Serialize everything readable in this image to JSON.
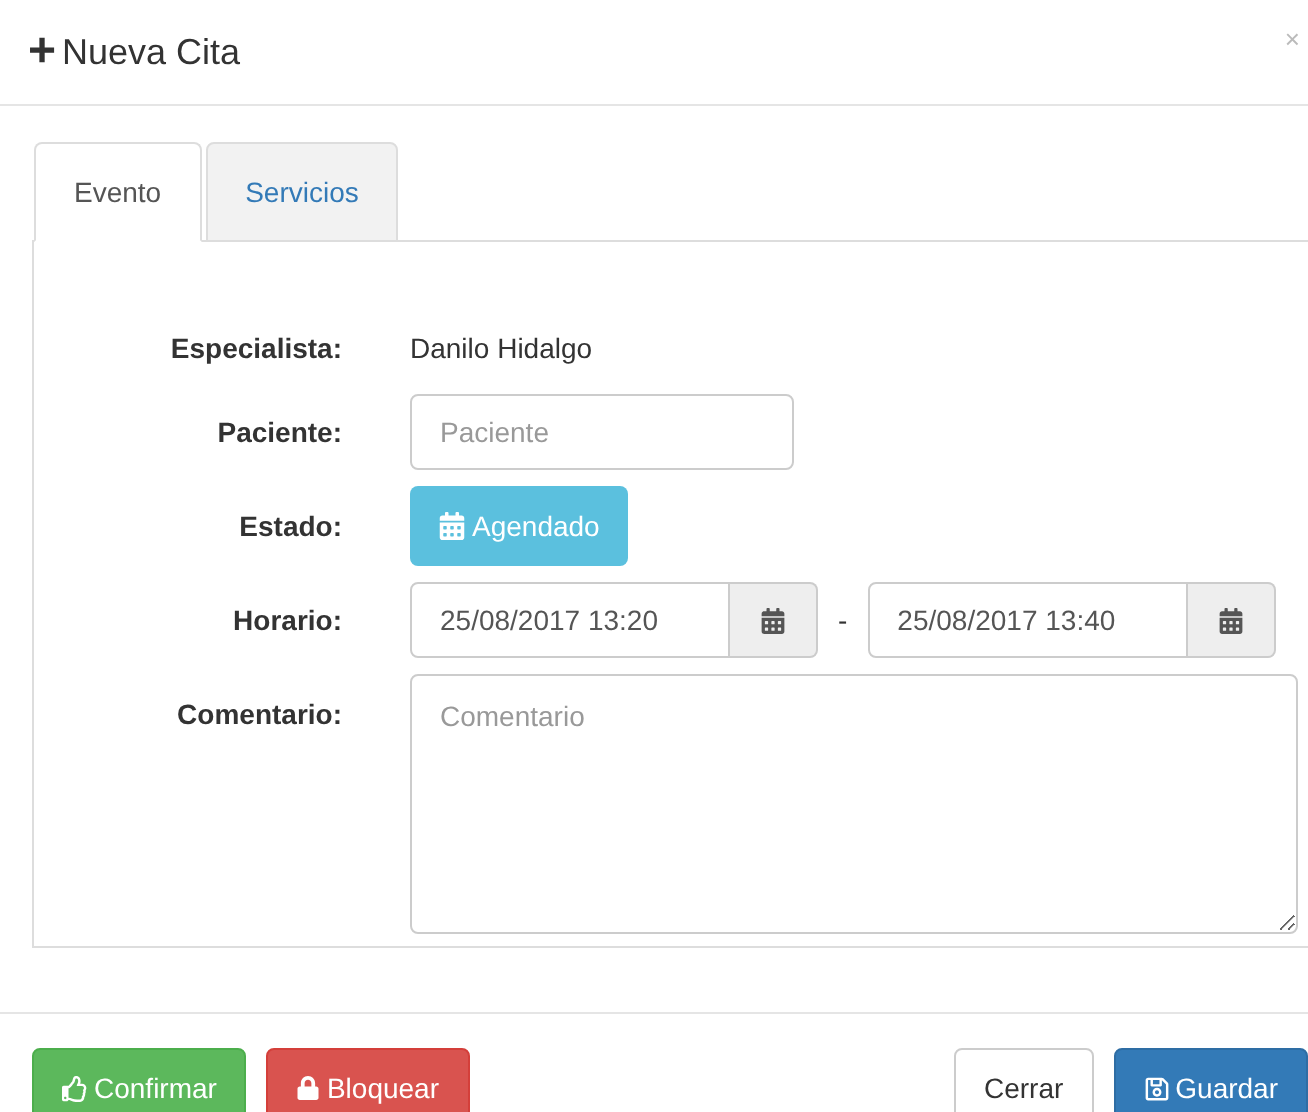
{
  "modal": {
    "icon": "+",
    "title": "Nueva Cita",
    "close": "×"
  },
  "tabs": [
    {
      "label": "Evento",
      "selected": true
    },
    {
      "label": "Servicios",
      "selected": false
    }
  ],
  "form": {
    "especialista": {
      "label": "Especialista:",
      "value": "Danilo Hidalgo"
    },
    "paciente": {
      "label": "Paciente:",
      "placeholder": "Paciente"
    },
    "estado": {
      "label": "Estado:",
      "value": "Agendado"
    },
    "horario": {
      "label": "Horario:",
      "start": "25/08/2017 13:20",
      "separator": "-",
      "end": "25/08/2017 13:40"
    },
    "comentario": {
      "label": "Comentario:",
      "placeholder": "Comentario"
    }
  },
  "footer_buttons": [
    {
      "label": "Confirmar",
      "kind": "success"
    },
    {
      "label": "Bloquear",
      "kind": "danger"
    },
    {
      "label": "Cerrar",
      "kind": "default"
    },
    {
      "label": "Guardar",
      "kind": "primary"
    }
  ]
}
